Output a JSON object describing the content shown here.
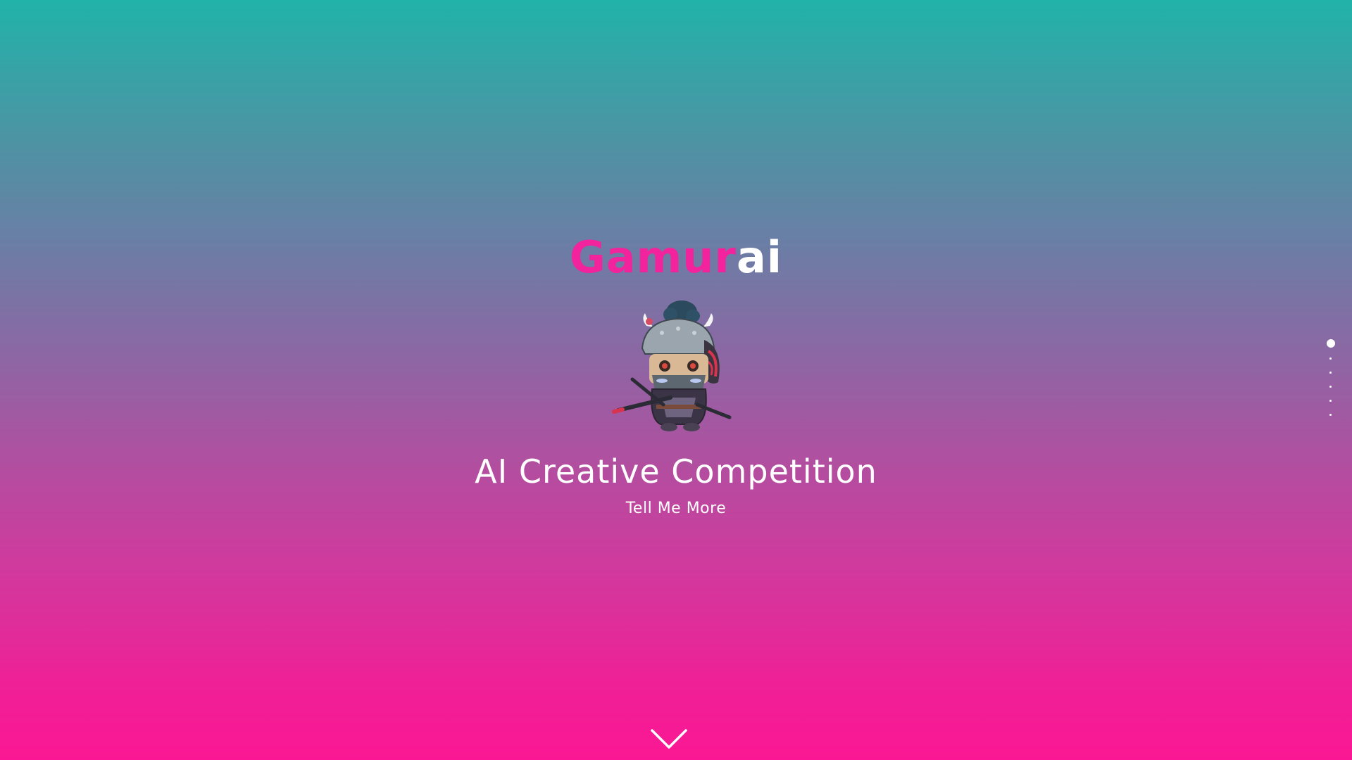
{
  "brand": {
    "logo_part1": "Gamur",
    "logo_part2": "ai",
    "pink": "#f2239c",
    "gradient_top": "#21b3aa",
    "gradient_bottom": "#fb1793"
  },
  "hero": {
    "headline": "AI Creative Competition",
    "cta_label": "Tell Me More",
    "mascot_icon": "samurai-mascot-icon"
  },
  "section_nav": {
    "count": 6,
    "active_index": 0
  },
  "scroll": {
    "icon": "chevron-down-icon"
  }
}
